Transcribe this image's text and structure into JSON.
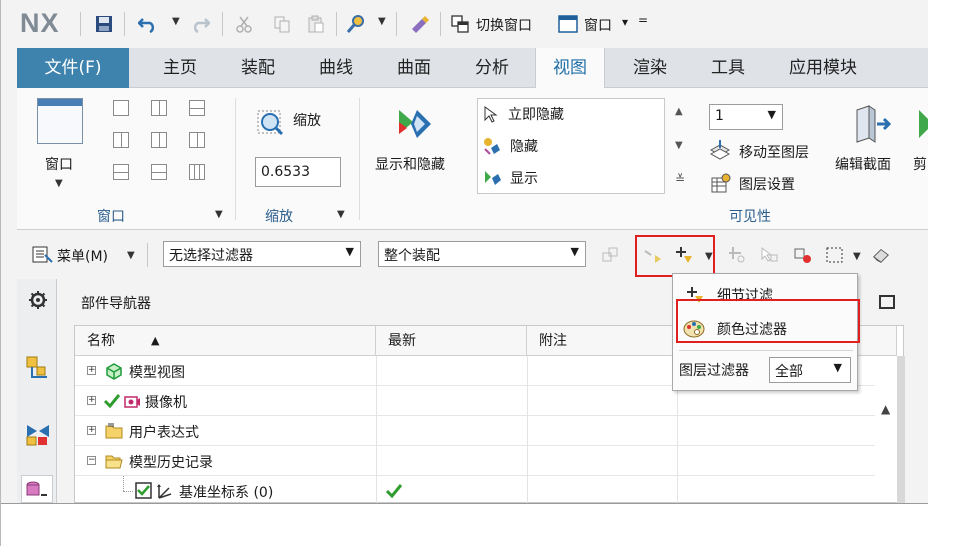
{
  "qat": {
    "logo": "NX",
    "switch_window": "切换窗口",
    "window_menu": "窗口",
    "window_menu_arrow": "▾",
    "more": "="
  },
  "tabs": {
    "file": "文件(F)",
    "items": [
      "主页",
      "装配",
      "曲线",
      "曲面",
      "分析",
      "视图",
      "渲染",
      "工具",
      "应用模块"
    ],
    "active": "视图"
  },
  "ribbon": {
    "window_group": {
      "button": "窗口",
      "label": "窗口"
    },
    "zoom_group": {
      "button": "缩放",
      "value": "0.6533",
      "label": "缩放"
    },
    "show_hide": {
      "button": "显示和隐藏"
    },
    "hide_list": [
      "立即隐藏",
      "隐藏",
      "显示"
    ],
    "visibility_group": {
      "layer_value": "1",
      "move_to_layer": "移动至图层",
      "layer_settings": "图层设置",
      "edit_section": "编辑截面",
      "cut": "剪",
      "label": "可见性"
    }
  },
  "selection_bar": {
    "menu": "菜单(M)",
    "filter": "无选择过滤器",
    "scope": "整个装配"
  },
  "navigator": {
    "title": "部件导航器",
    "columns": [
      "名称",
      "最新",
      "附注"
    ],
    "rows": [
      {
        "label": "模型视图"
      },
      {
        "label": "摄像机"
      },
      {
        "label": "用户表达式"
      },
      {
        "label": "模型历史记录"
      },
      {
        "label": "基准坐标系 (0)"
      }
    ]
  },
  "popup": {
    "detail_filter": "细节过滤",
    "color_filter": "颜色过滤器",
    "layer_filter_label": "图层过滤器",
    "layer_filter_value": "全部"
  },
  "colors": {
    "file_tab": "#3e83ad",
    "active_tab_text": "#1f6fa8",
    "highlight_box": "#e0201f",
    "check_green": "#2f9e2f"
  }
}
